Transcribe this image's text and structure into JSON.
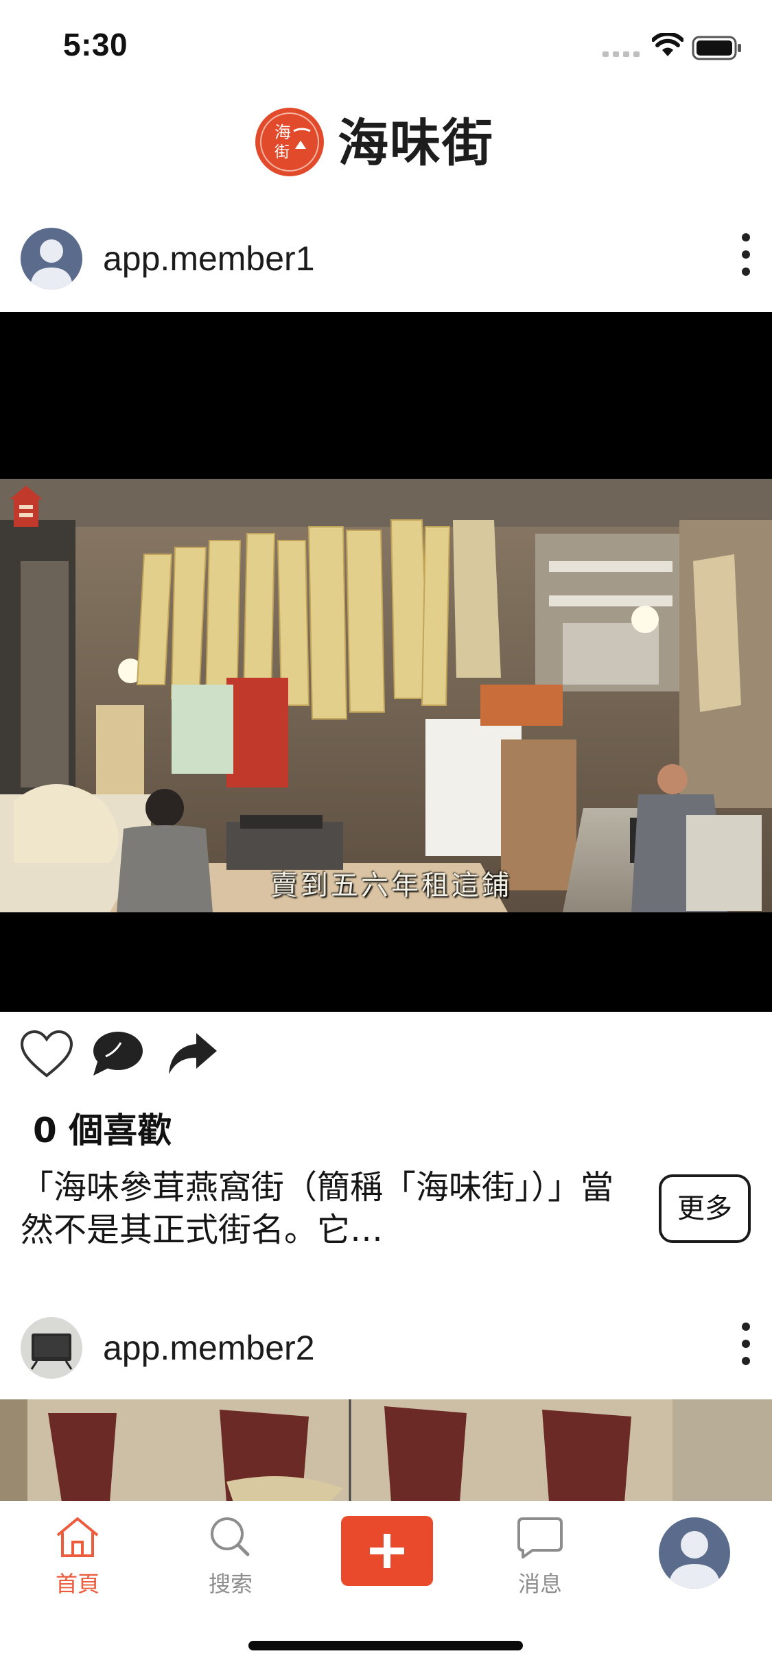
{
  "status_bar": {
    "time": "5:30"
  },
  "header": {
    "logo_text": "海味街",
    "seal_text": "海味街"
  },
  "posts": [
    {
      "username": "app.member1",
      "video_subtitle": "賣到五六年租這鋪",
      "likes_text": "0 個喜歡",
      "caption": "「海味參茸燕窩街（簡稱「海味街」）」當然不是其正式街名。它…",
      "more_label": "更多"
    },
    {
      "username": "app.member2"
    }
  ],
  "tabbar": {
    "items": [
      {
        "label": "首頁",
        "icon": "home-icon",
        "active": true
      },
      {
        "label": "搜索",
        "icon": "search-icon",
        "active": false
      },
      {
        "label": "",
        "icon": "plus-icon",
        "active": false
      },
      {
        "label": "消息",
        "icon": "message-icon",
        "active": false
      },
      {
        "label": "",
        "icon": "profile-avatar-icon",
        "active": false
      }
    ]
  },
  "colors": {
    "accent": "#e94a2b",
    "active_tab": "#ec5b3b",
    "inactive_tab": "#8d8d8d",
    "avatar_bg": "#5a6b8c"
  }
}
